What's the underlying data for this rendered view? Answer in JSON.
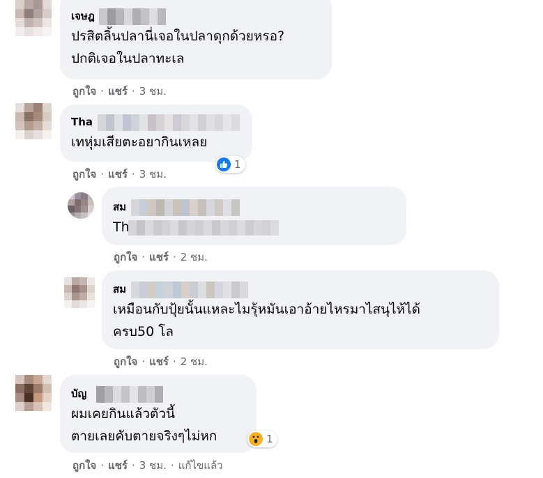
{
  "colors": {
    "bubble": "#f0f2f5",
    "meta_text": "#65676b",
    "like_blue": "#1877f2",
    "wow_yellow": "#f7b125"
  },
  "actions": {
    "like": "ถูกใจ",
    "share": "แชร์",
    "separator": "·"
  },
  "comments": [
    {
      "author_visible": "เจษฎ",
      "body": [
        "ปรสิตลิ้นปลานี่เจอในปลาดุกด้วยหรอ?",
        "ปกติเจอในปลาทะเล"
      ],
      "time": "3 ชม."
    },
    {
      "author_visible": "Tha",
      "body": [
        "เทหุ่มเสียตะอยากินเหลย"
      ],
      "time": "3 ชม.",
      "reaction": {
        "icon": "like-icon",
        "count": "1"
      }
    },
    {
      "author_visible": "สม",
      "body": [
        "Th                        on แกงก้ายังฉ้อ"
      ],
      "time": "2 ชม."
    },
    {
      "author_visible": "สม",
      "body": [
        "เหมือนกับปุ้ยนั้นแหละไมรุ้หมันเอาอ้ายไหรมาไสนุไห้ได้",
        "ครบ50 โล"
      ],
      "time": "2 ชม."
    },
    {
      "author_visible": "บัญ",
      "body": [
        "ผมเคยกินแล้วตัวนี้",
        "ตายเลยคับตายจริงๆไม่หก"
      ],
      "time": "3 ชม.",
      "edited": "แก้ไขแล้ว",
      "reaction": {
        "icon": "wow-icon",
        "count": "1"
      }
    }
  ]
}
